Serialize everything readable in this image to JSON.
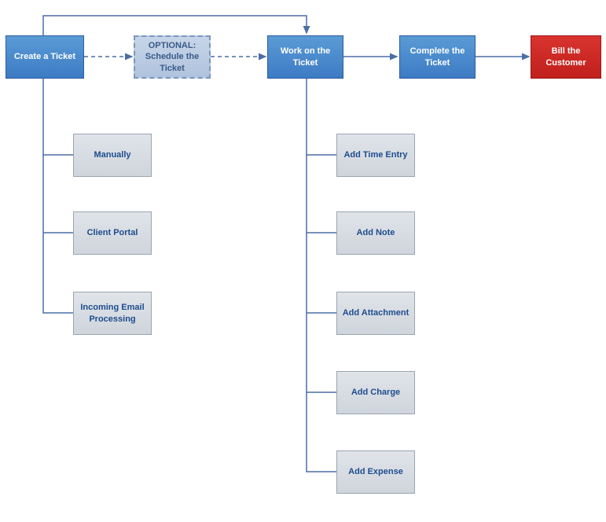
{
  "main_flow": {
    "create": "Create a Ticket",
    "optional": "OPTIONAL: Schedule the Ticket",
    "work": "Work on the Ticket",
    "complete": "Complete the Ticket",
    "bill": "Bill the Customer"
  },
  "create_children": {
    "manually": "Manually",
    "client_portal": "Client Portal",
    "email": "Incoming Email Processing"
  },
  "work_children": {
    "time": "Add Time Entry",
    "note": "Add Note",
    "attachment": "Add Attachment",
    "charge": "Add Charge",
    "expense": "Add Expense"
  }
}
